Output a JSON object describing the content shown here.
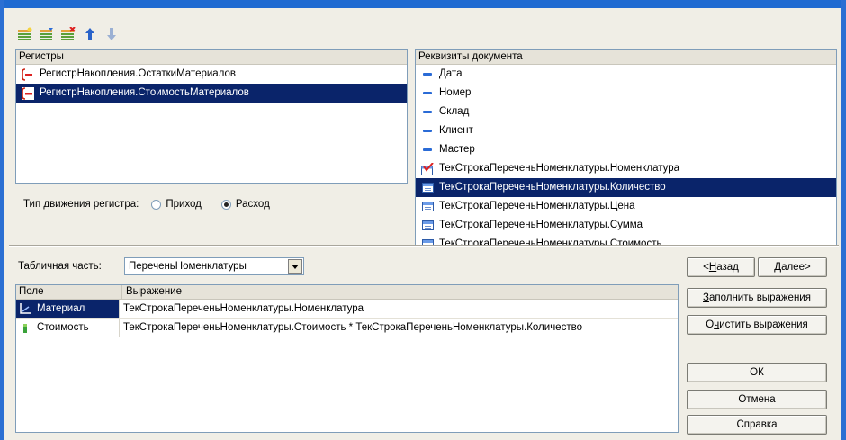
{
  "toolbar": {
    "buttons": [
      "add-movement-icon",
      "add-movement-auto-icon",
      "delete-movement-icon",
      "move-up-icon",
      "move-down-icon"
    ]
  },
  "registers": {
    "header": "Регистры",
    "items": [
      {
        "label": "РегистрНакопления.ОстаткиМатериалов",
        "selected": false
      },
      {
        "label": "РегистрНакопления.СтоимостьМатериалов",
        "selected": true
      }
    ]
  },
  "movement_type": {
    "label": "Тип движения регистра:",
    "options": [
      {
        "label": "Приход",
        "checked": false
      },
      {
        "label": "Расход",
        "checked": true
      }
    ]
  },
  "requisites": {
    "header": "Реквизиты документа",
    "items": [
      {
        "label": "Дата",
        "icon": "attribute-icon",
        "selected": false
      },
      {
        "label": "Номер",
        "icon": "attribute-icon",
        "selected": false
      },
      {
        "label": "Склад",
        "icon": "attribute-icon",
        "selected": false
      },
      {
        "label": "Клиент",
        "icon": "attribute-icon",
        "selected": false
      },
      {
        "label": "Мастер",
        "icon": "attribute-icon",
        "selected": false
      },
      {
        "label": "ТекСтрокаПереченьНоменклатуры.Номенклатура",
        "icon": "table-attribute-used-icon",
        "selected": false
      },
      {
        "label": "ТекСтрокаПереченьНоменклатуры.Количество",
        "icon": "table-attribute-icon",
        "selected": true
      },
      {
        "label": "ТекСтрокаПереченьНоменклатуры.Цена",
        "icon": "table-attribute-icon",
        "selected": false
      },
      {
        "label": "ТекСтрокаПереченьНоменклатуры.Сумма",
        "icon": "table-attribute-icon",
        "selected": false
      },
      {
        "label": "ТекСтрокаПереченьНоменклатуры.Стоимость",
        "icon": "table-attribute-icon",
        "selected": false
      }
    ]
  },
  "tabular": {
    "label": "Табличная часть:",
    "value": "ПереченьНоменклатуры"
  },
  "grid": {
    "columns": [
      "Поле",
      "Выражение"
    ],
    "rows": [
      {
        "field": "Материал",
        "expression": "ТекСтрокаПереченьНоменклатуры.Номенклатура",
        "icon": "dimension-icon",
        "selected": true
      },
      {
        "field": "Стоимость",
        "expression": "ТекСтрокаПереченьНоменклатуры.Стоимость * ТекСтрокаПереченьНоменклатуры.Количество",
        "icon": "resource-icon",
        "selected": false
      }
    ]
  },
  "buttons": {
    "back": "<Назад",
    "next": "Далее>",
    "fill": "Заполнить выражения",
    "clear": "Очистить выражения",
    "ok": "ОК",
    "cancel": "Отмена",
    "help": "Справка"
  }
}
